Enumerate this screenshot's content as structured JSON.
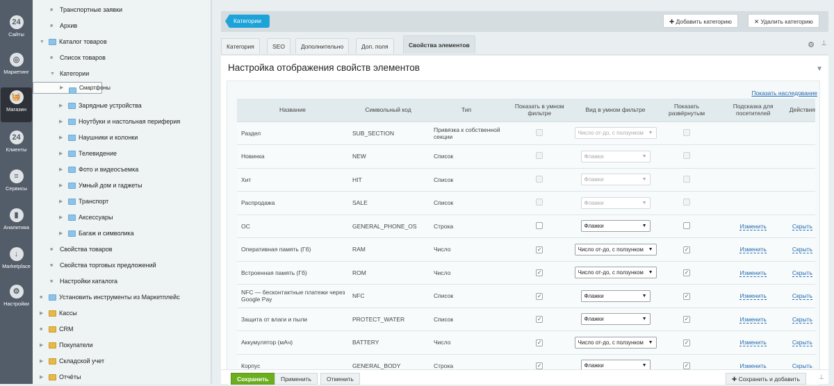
{
  "nav": [
    {
      "label": "Сайты",
      "icon": "24"
    },
    {
      "label": "Маркетинг",
      "icon": "◎"
    },
    {
      "label": "Магазин",
      "icon": "🧺"
    },
    {
      "label": "Клиенты",
      "icon": "24"
    },
    {
      "label": "Сервисы",
      "icon": "≡"
    },
    {
      "label": "Аналитика",
      "icon": "▮"
    },
    {
      "label": "Marketplace",
      "icon": "↓"
    },
    {
      "label": "Настройки",
      "icon": "⚙"
    }
  ],
  "tree": [
    {
      "label": "Транспортные заявки",
      "lvl": 1,
      "kind": "dot"
    },
    {
      "label": "Архив",
      "lvl": 1,
      "kind": "dot"
    },
    {
      "label": "Каталог товаров",
      "lvl": 0,
      "kind": "open-folder"
    },
    {
      "label": "Список товаров",
      "lvl": 1,
      "kind": "dot"
    },
    {
      "label": "Категории",
      "lvl": 1,
      "kind": "open"
    },
    {
      "label": "Смартфоны",
      "lvl": 2,
      "kind": "folder",
      "selected": true
    },
    {
      "label": "Зарядные устройства",
      "lvl": 2,
      "kind": "folder"
    },
    {
      "label": "Ноутбуки и настольная периферия",
      "lvl": 2,
      "kind": "folder"
    },
    {
      "label": "Наушники и колонки",
      "lvl": 2,
      "kind": "folder"
    },
    {
      "label": "Телевидение",
      "lvl": 2,
      "kind": "folder"
    },
    {
      "label": "Фото и видеосъемка",
      "lvl": 2,
      "kind": "folder"
    },
    {
      "label": "Умный дом и гаджеты",
      "lvl": 2,
      "kind": "folder"
    },
    {
      "label": "Транспорт",
      "lvl": 2,
      "kind": "folder"
    },
    {
      "label": "Аксессуары",
      "lvl": 2,
      "kind": "folder"
    },
    {
      "label": "Багаж и символика",
      "lvl": 2,
      "kind": "folder"
    },
    {
      "label": "Свойства товаров",
      "lvl": 1,
      "kind": "dot"
    },
    {
      "label": "Свойства торговых предложений",
      "lvl": 1,
      "kind": "dot"
    },
    {
      "label": "Настройки каталога",
      "lvl": 1,
      "kind": "dot"
    },
    {
      "label": "Установить инструменты из Маркетплейс",
      "lvl": 0,
      "kind": "dot-folder"
    },
    {
      "label": "Кассы",
      "lvl": 0,
      "kind": "icon"
    },
    {
      "label": "CRM",
      "lvl": 0,
      "kind": "dot-icon"
    },
    {
      "label": "Покупатели",
      "lvl": 0,
      "kind": "icon"
    },
    {
      "label": "Складской учет",
      "lvl": 0,
      "kind": "icon"
    },
    {
      "label": "Отчёты",
      "lvl": 0,
      "kind": "icon"
    }
  ],
  "toolbar": {
    "breadcrumb": "Категории",
    "add": "Добавить категорию",
    "delete": "Удалить категорию"
  },
  "tabs": [
    "Категория",
    "SEO",
    "Дополнительно",
    "Доп. поля",
    "Свойства элементов"
  ],
  "panel": {
    "title": "Настройка отображения свойств элементов",
    "inherit_link": "Показать наследование"
  },
  "table": {
    "headers": [
      "Название",
      "Символьный код",
      "Тип",
      "Показать в умном фильтре",
      "Вид в умном фильтре",
      "Показать развёрнутым",
      "Подсказка для посетителей",
      "Действия"
    ],
    "edit_label": "Изменить",
    "hide_label": "Скрыть",
    "rows": [
      {
        "name": "Раздел",
        "code": "SUB_SECTION",
        "type": "Привязка к собственной секции",
        "filter": false,
        "view": "Число от-до, с ползунком",
        "expanded": false,
        "disabled": true
      },
      {
        "name": "Новинка",
        "code": "NEW",
        "type": "Список",
        "filter": false,
        "view": "Флажки",
        "expanded": false,
        "disabled": true
      },
      {
        "name": "Хит",
        "code": "HIT",
        "type": "Список",
        "filter": false,
        "view": "Флажки",
        "expanded": false,
        "disabled": true
      },
      {
        "name": "Распродажа",
        "code": "SALE",
        "type": "Список",
        "filter": false,
        "view": "Флажки",
        "expanded": false,
        "disabled": true
      },
      {
        "name": "ОС",
        "code": "GENERAL_PHONE_OS",
        "type": "Строка",
        "filter": false,
        "view": "Флажки",
        "expanded": false,
        "disabled": false
      },
      {
        "name": "Оперативная память (Гб)",
        "code": "RAM",
        "type": "Число",
        "filter": true,
        "view": "Число от-до, с ползунком",
        "expanded": true,
        "disabled": false
      },
      {
        "name": "Встроенная память (Гб)",
        "code": "ROM",
        "type": "Число",
        "filter": true,
        "view": "Число от-до, с ползунком",
        "expanded": true,
        "disabled": false
      },
      {
        "name": "NFC — бесконтактные платежи через Google Pay",
        "code": "NFC",
        "type": "Список",
        "filter": true,
        "view": "Флажки",
        "expanded": true,
        "disabled": false
      },
      {
        "name": "Защита от влаги и пыли",
        "code": "PROTECT_WATER",
        "type": "Список",
        "filter": true,
        "view": "Флажки",
        "expanded": true,
        "disabled": false
      },
      {
        "name": "Аккумулятор (мАч)",
        "code": "BATTERY",
        "type": "Число",
        "filter": true,
        "view": "Число от-до, с ползунком",
        "expanded": true,
        "disabled": false
      },
      {
        "name": "Корпус",
        "code": "GENERAL_BODY",
        "type": "Строка",
        "filter": true,
        "view": "Флажки",
        "expanded": true,
        "disabled": false
      }
    ]
  },
  "footer": {
    "save": "Сохранить",
    "apply": "Применить",
    "cancel": "Отменить",
    "save_add": "Сохранить и добавить"
  }
}
